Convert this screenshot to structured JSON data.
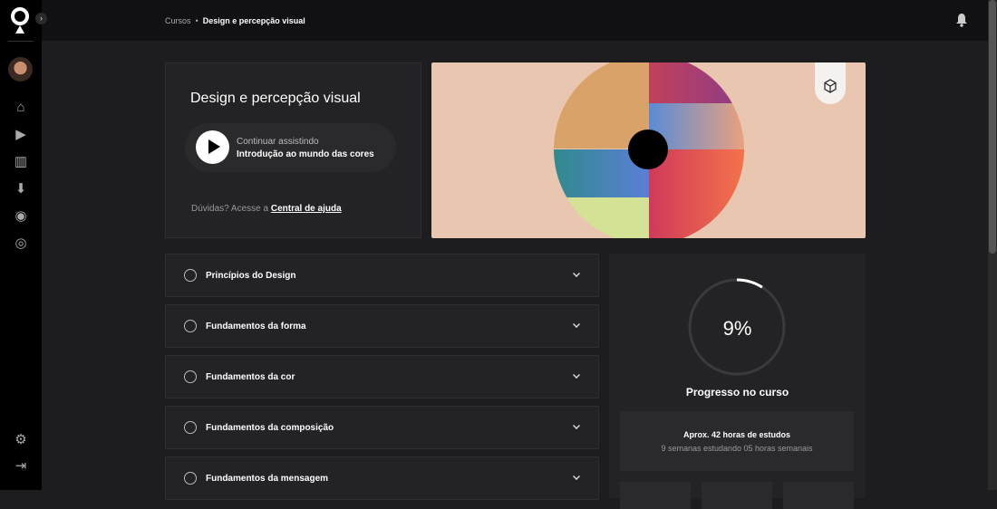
{
  "breadcrumb": {
    "root": "Cursos",
    "separator": "•",
    "current": "Design e percepção visual"
  },
  "hero": {
    "title": "Design e percepção visual",
    "continue_label": "Continuar assistindo",
    "lesson": "Introdução ao mundo das cores",
    "help_text": "Dúvidas? Acesse a",
    "help_link": "Central de ajuda"
  },
  "modules": [
    {
      "title": "Princípios do Design"
    },
    {
      "title": "Fundamentos da forma"
    },
    {
      "title": "Fundamentos da cor"
    },
    {
      "title": "Fundamentos da composição"
    },
    {
      "title": "Fundamentos da mensagem"
    }
  ],
  "progress": {
    "percent": 9,
    "percent_label": "9%",
    "label": "Progresso no curso",
    "hours": "Aprox. 42 horas de estudos",
    "schedule": "9 semanas estudando 05 horas semanais"
  }
}
